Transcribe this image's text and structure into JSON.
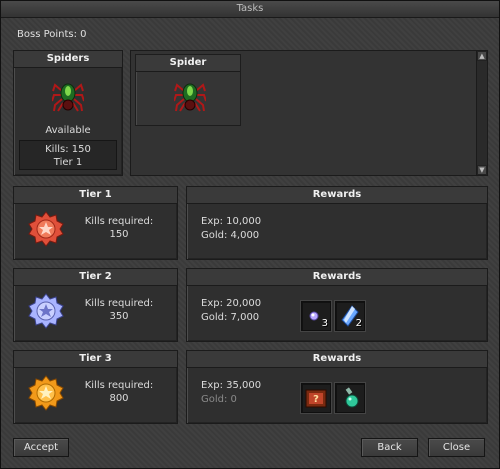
{
  "window": {
    "title": "Tasks"
  },
  "boss_points": "Boss Points: 0",
  "monster_card": {
    "header": "Spiders",
    "status": "Available",
    "kills": "Kills: 150",
    "tier": "Tier 1"
  },
  "list": {
    "items": [
      {
        "label": "Spider"
      }
    ]
  },
  "tiers": [
    {
      "title": "Tier 1",
      "req_label": "Kills required:",
      "req_value": "150"
    },
    {
      "title": "Tier 2",
      "req_label": "Kills required:",
      "req_value": "350"
    },
    {
      "title": "Tier 3",
      "req_label": "Kills required:",
      "req_value": "800"
    }
  ],
  "rewards": [
    {
      "title": "Rewards",
      "exp": "Exp: 10,000",
      "gold": "Gold: 4,000",
      "items": []
    },
    {
      "title": "Rewards",
      "exp": "Exp: 20,000",
      "gold": "Gold: 7,000",
      "items": [
        {
          "icon": "small-crystal-icon",
          "count": "3"
        },
        {
          "icon": "blue-crystal-icon",
          "count": "2"
        }
      ]
    },
    {
      "title": "Rewards",
      "exp": "Exp: 35,000",
      "gold": "Gold: 0",
      "items": [
        {
          "icon": "mystery-box-icon",
          "count": ""
        },
        {
          "icon": "potion-icon",
          "count": ""
        }
      ]
    }
  ],
  "buttons": {
    "accept": "Accept",
    "back": "Back",
    "close": "Close"
  },
  "colors": {
    "tier1": "#e0503a",
    "tier2": "#a9b4ff",
    "tier3": "#f29a1a"
  }
}
